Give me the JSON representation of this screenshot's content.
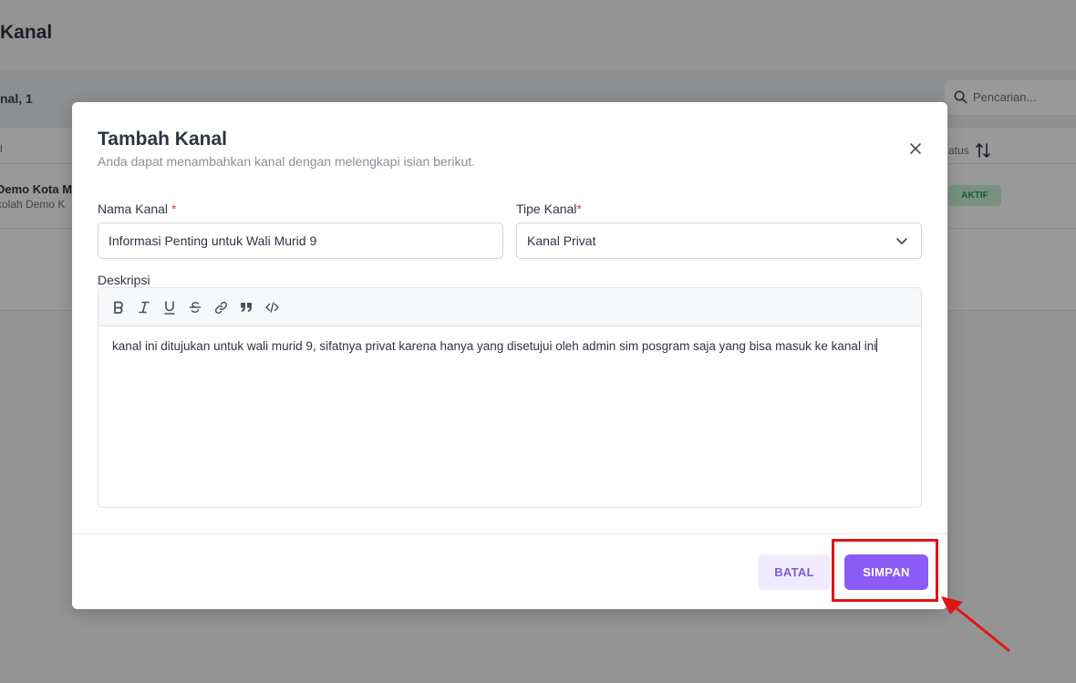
{
  "background": {
    "page_title": "Kanal",
    "count_label": "nal, 1",
    "search_placeholder": "Pencarian...",
    "table_header_left": "l",
    "table_header_status": "atus",
    "row_name": "Demo Kota M",
    "row_sub": "kolah Demo K",
    "row_status": "AKTIF",
    "colors": {
      "badge_bg": "#c9f1d6",
      "badge_text": "#2e9d57"
    }
  },
  "modal": {
    "title": "Tambah Kanal",
    "subtitle": "Anda dapat menambahkan kanal dengan melengkapi isian berikut.",
    "name_label": "Nama Kanal",
    "required_mark": "*",
    "name_value": "Informasi Penting untuk Wali Murid 9",
    "type_label": "Tipe Kanal",
    "type_value": "Kanal Privat",
    "description_label": "Deskripsi",
    "toolbar": [
      "bold-icon",
      "italic-icon",
      "underline-icon",
      "strikethrough-icon",
      "link-icon",
      "quote-icon",
      "code-icon"
    ],
    "description_value": "kanal ini ditujukan untuk wali murid 9, sifatnya privat karena hanya yang disetujui oleh admin sim posgram saja yang bisa masuk ke kanal ini",
    "cancel_label": "BATAL",
    "save_label": "SIMPAN",
    "colors": {
      "primary": "#8a5cf5",
      "cancel_bg": "#f1ecfd",
      "annotation": "#e11515"
    }
  }
}
